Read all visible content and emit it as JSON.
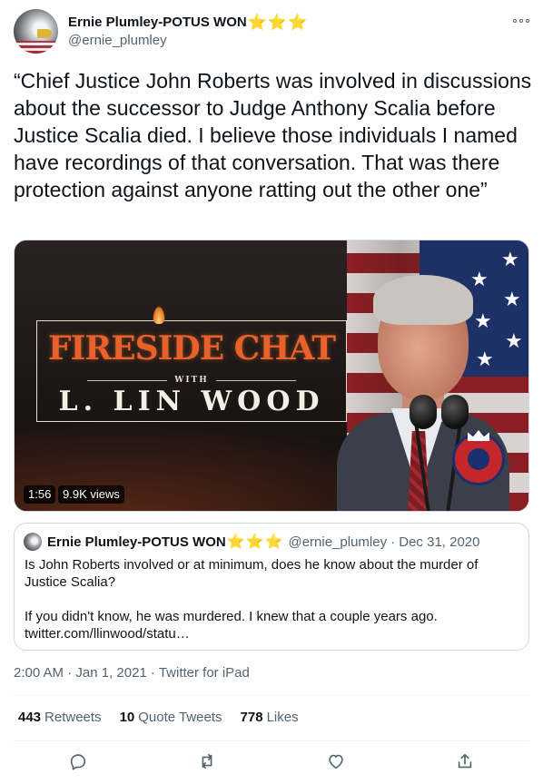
{
  "author": {
    "display_name": "Ernie Plumley-POTUS WON",
    "handle": "@ernie_plumley",
    "badges": [
      "⭐",
      "⭐",
      "⭐"
    ]
  },
  "tweet": {
    "text": "“Chief Justice John Roberts was involved in discussions about the successor to Judge Anthony Scalia before Justice Scalia died. I believe those individuals I named have recordings of that conversation. That was there protection against anyone ratting out the other one”",
    "timestamp": "2:00 AM · Jan 1, 2021 · Twitter for iPad"
  },
  "video": {
    "title_main": "FIRESIDE CHAT",
    "title_with": "WITH",
    "title_name": "L. LIN WOOD",
    "duration": "1:56",
    "views": "9.9K views"
  },
  "quoted_tweet": {
    "display_name": "Ernie Plumley-POTUS WON",
    "badges": [
      "⭐",
      "⭐",
      "⭐"
    ],
    "handle": "@ernie_plumley",
    "date": "· Dec 31, 2020",
    "text_line1": "Is John Roberts involved or at minimum, does he know about the murder of Justice Scalia?",
    "text_line2": "If you didn't know, he was murdered. I knew that a couple years ago. twitter.com/llinwood/statu…"
  },
  "stats": {
    "retweets_count": "443",
    "retweets_label": "Retweets",
    "quote_count": "10",
    "quote_label": "Quote Tweets",
    "likes_count": "778",
    "likes_label": "Likes"
  },
  "icons": {
    "more": "more-icon",
    "reply": "reply-icon",
    "retweet": "retweet-icon",
    "like": "heart-icon",
    "share": "share-icon"
  }
}
